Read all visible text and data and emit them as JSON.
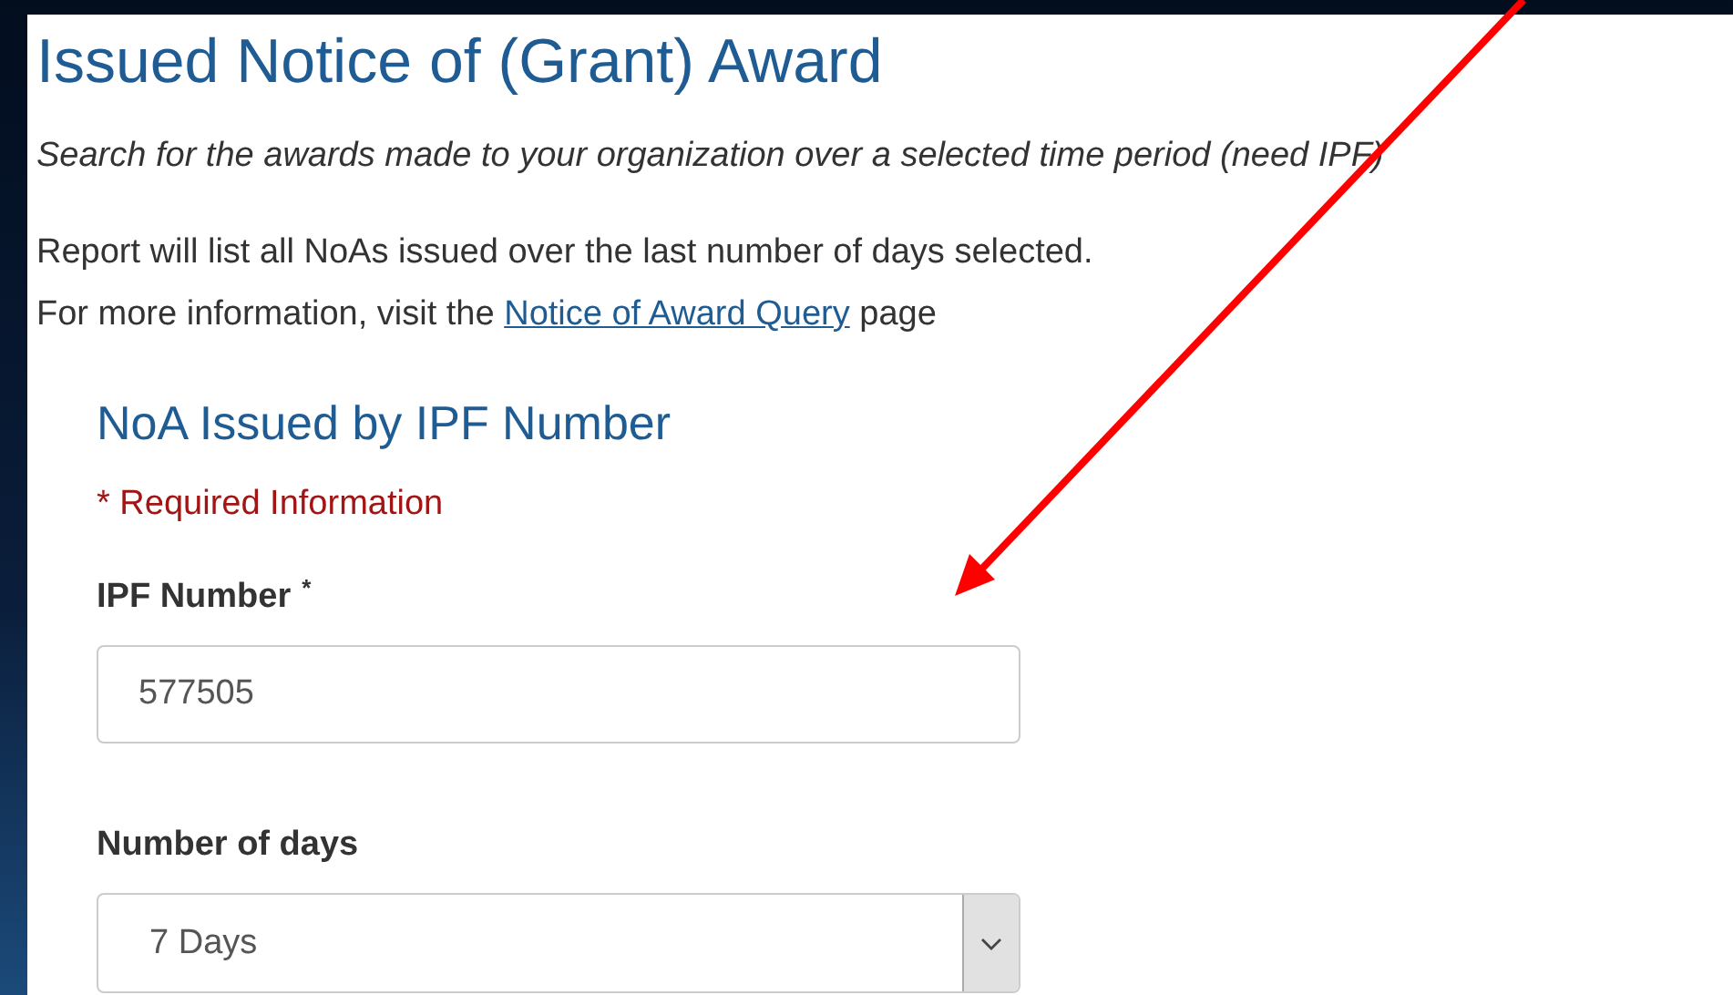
{
  "page": {
    "title": "Issued Notice of (Grant) Award",
    "subtitle": "Search for the awards made to your organization over a selected time period (need IPF)",
    "intro": "Report will list all NoAs issued over the last number of days selected.",
    "more_info": {
      "before": "For more information, visit the",
      "link": "Notice of Award Query",
      "after": "page"
    }
  },
  "form": {
    "heading": "NoA Issued by IPF Number",
    "required_note": "* Required Information",
    "fields": [
      {
        "kind": "text",
        "label": "IPF Number",
        "required_mark": "*",
        "value": "577505"
      },
      {
        "kind": "select",
        "label": "Number of days",
        "value": "7 Days"
      }
    ]
  },
  "annotation": {
    "kind": "arrow"
  }
}
